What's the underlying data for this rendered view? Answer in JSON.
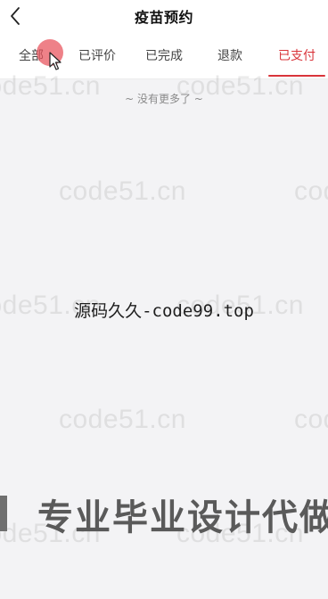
{
  "header": {
    "title": "疫苗预约",
    "back_icon": "back-chevron-icon"
  },
  "tabs": [
    {
      "label": "全部",
      "active": false
    },
    {
      "label": "已评价",
      "active": false
    },
    {
      "label": "已完成",
      "active": false
    },
    {
      "label": "退款",
      "active": false
    },
    {
      "label": "已支付",
      "active": true
    }
  ],
  "list": {
    "empty_text": "~ 没有更多了 ~"
  },
  "watermark": {
    "text": "code51.cn"
  },
  "overlay": {
    "center_text": "源码久久-code99.top",
    "banner_text": "专业毕业设计代做"
  },
  "colors": {
    "accent": "#d9343a",
    "background": "#f3f3f5",
    "touch_indicator": "#e8505a"
  }
}
